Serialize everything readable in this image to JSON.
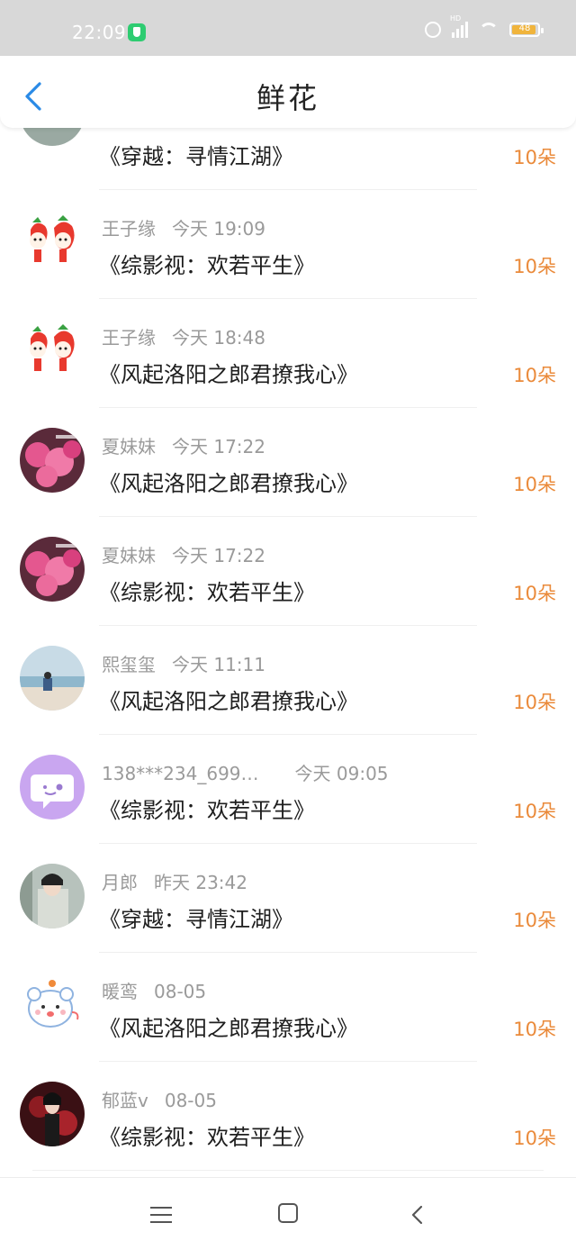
{
  "status_bar": {
    "time": "22:09",
    "battery": "48",
    "hd_label": "HD"
  },
  "header": {
    "title": "鲜花",
    "back_icon": "chevron-left-icon"
  },
  "colors": {
    "accent": "#2a8ae6",
    "flower_count": "#ea8a3a",
    "meta_text": "#9a9a9a"
  },
  "list": {
    "partial_top": {
      "book": "《穿越：寻情江湖》",
      "flowers": "10朵"
    },
    "items": [
      {
        "user": "王子缘",
        "time": "今天 19:09",
        "book": "《综影视：欢若平生》",
        "flowers": "10朵",
        "avatar": "strawberry-cartoon"
      },
      {
        "user": "王子缘",
        "time": "今天 18:48",
        "book": "《风起洛阳之郎君撩我心》",
        "flowers": "10朵",
        "avatar": "strawberry-cartoon"
      },
      {
        "user": "夏妹妹",
        "time": "今天 17:22",
        "book": "《风起洛阳之郎君撩我心》",
        "flowers": "10朵",
        "avatar": "pink-blossom"
      },
      {
        "user": "夏妹妹",
        "time": "今天 17:22",
        "book": "《综影视：欢若平生》",
        "flowers": "10朵",
        "avatar": "pink-blossom"
      },
      {
        "user": "熙玺玺",
        "time": "今天 11:11",
        "book": "《风起洛阳之郎君撩我心》",
        "flowers": "10朵",
        "avatar": "beach-scene"
      },
      {
        "user": "138***234_699…",
        "time": "今天 09:05",
        "book": "《综影视：欢若平生》",
        "flowers": "10朵",
        "avatar": "default-chat-bubble"
      },
      {
        "user": "月郎",
        "time": "昨天 23:42",
        "book": "《穿越：寻情江湖》",
        "flowers": "10朵",
        "avatar": "costume-portrait"
      },
      {
        "user": "暖鸾",
        "time": "08-05",
        "book": "《风起洛阳之郎君撩我心》",
        "flowers": "10朵",
        "avatar": "cute-bear-sticker"
      },
      {
        "user": "郁蓝v",
        "time": "08-05",
        "book": "《综影视：欢若平生》",
        "flowers": "10朵",
        "avatar": "dark-red-portrait"
      }
    ]
  },
  "navbar": {
    "menu_icon": "menu-icon",
    "home_icon": "home-square-icon",
    "back_icon": "back-triangle-icon"
  }
}
